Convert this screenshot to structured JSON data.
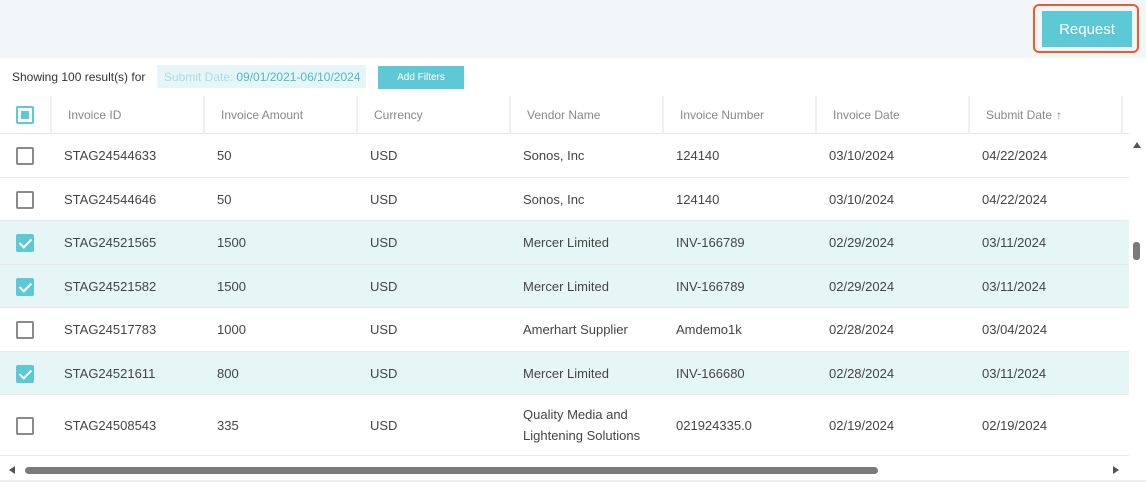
{
  "header": {
    "request_label": "Request"
  },
  "filters": {
    "showing": "Showing 100 result(s) for",
    "chip_label": "Submit Date:",
    "chip_value": "09/01/2021-06/10/2024",
    "add_filters_label": "Add Filters"
  },
  "table": {
    "columns": [
      "Invoice ID",
      "Invoice Amount",
      "Currency",
      "Vendor Name",
      "Invoice Number",
      "Invoice Date",
      "Submit Date"
    ],
    "sort_icon": "arrow-up-icon",
    "rows": [
      {
        "checked": false,
        "invoice_id": "STAG24544633",
        "amount": "50",
        "currency": "USD",
        "vendor": "Sonos, Inc",
        "vendor_line2": "",
        "number": "124140",
        "invoice_date": "03/10/2024",
        "submit_date": "04/22/2024"
      },
      {
        "checked": false,
        "invoice_id": "STAG24544646",
        "amount": "50",
        "currency": "USD",
        "vendor": "Sonos, Inc",
        "vendor_line2": "",
        "number": "124140",
        "invoice_date": "03/10/2024",
        "submit_date": "04/22/2024"
      },
      {
        "checked": true,
        "invoice_id": "STAG24521565",
        "amount": "1500",
        "currency": "USD",
        "vendor": "Mercer Limited",
        "vendor_line2": "",
        "number": "INV-166789",
        "invoice_date": "02/29/2024",
        "submit_date": "03/11/2024"
      },
      {
        "checked": true,
        "invoice_id": "STAG24521582",
        "amount": "1500",
        "currency": "USD",
        "vendor": "Mercer Limited",
        "vendor_line2": "",
        "number": "INV-166789",
        "invoice_date": "02/29/2024",
        "submit_date": "03/11/2024"
      },
      {
        "checked": false,
        "invoice_id": "STAG24517783",
        "amount": "1000",
        "currency": "USD",
        "vendor": "Amerhart Supplier",
        "vendor_line2": "",
        "number": "Amdemo1k",
        "invoice_date": "02/28/2024",
        "submit_date": "03/04/2024"
      },
      {
        "checked": true,
        "invoice_id": "STAG24521611",
        "amount": "800",
        "currency": "USD",
        "vendor": "Mercer Limited",
        "vendor_line2": "",
        "number": "INV-166680",
        "invoice_date": "02/28/2024",
        "submit_date": "03/11/2024"
      },
      {
        "checked": false,
        "invoice_id": "STAG24508543",
        "amount": "335",
        "currency": "USD",
        "vendor": "Quality Media and",
        "vendor_line2": "Lightening Solutions",
        "number": "021924335.0",
        "invoice_date": "02/19/2024",
        "submit_date": "02/19/2024"
      }
    ]
  },
  "colors": {
    "accent": "#5ec9d6",
    "highlight": "#f05a28",
    "row_checked": "#e6f6f7"
  }
}
